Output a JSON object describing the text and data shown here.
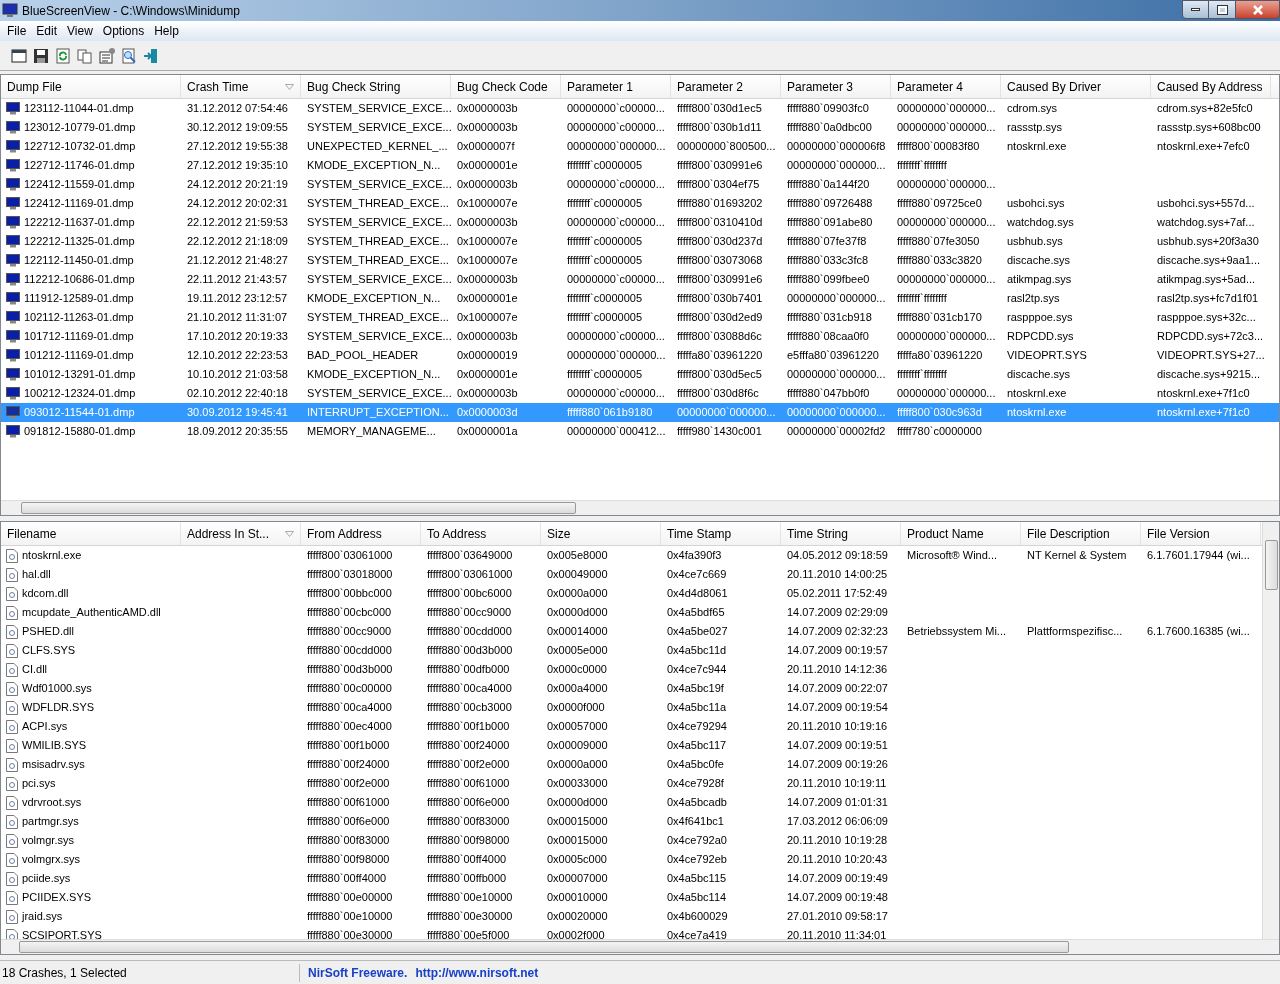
{
  "window": {
    "title": "BlueScreenView  -  C:\\Windows\\Minidump"
  },
  "menu": [
    "File",
    "Edit",
    "View",
    "Options",
    "Help"
  ],
  "crash_list": {
    "columns": [
      {
        "label": "Dump File",
        "sorted": false
      },
      {
        "label": "Crash Time",
        "sorted": true
      },
      {
        "label": "Bug Check String",
        "sorted": false
      },
      {
        "label": "Bug Check Code",
        "sorted": false
      },
      {
        "label": "Parameter 1",
        "sorted": false
      },
      {
        "label": "Parameter 2",
        "sorted": false
      },
      {
        "label": "Parameter 3",
        "sorted": false
      },
      {
        "label": "Parameter 4",
        "sorted": false
      },
      {
        "label": "Caused By Driver",
        "sorted": false
      },
      {
        "label": "Caused By Address",
        "sorted": false
      }
    ],
    "rows": [
      {
        "selected": false,
        "cells": [
          "123112-11044-01.dmp",
          "31.12.2012 07:54:46",
          "SYSTEM_SERVICE_EXCE...",
          "0x0000003b",
          "00000000`c00000...",
          "fffff800`030d1ec5",
          "fffff880`09903fc0",
          "00000000`000000...",
          "cdrom.sys",
          "cdrom.sys+82e5fc0"
        ]
      },
      {
        "selected": false,
        "cells": [
          "123012-10779-01.dmp",
          "30.12.2012 19:09:55",
          "SYSTEM_SERVICE_EXCE...",
          "0x0000003b",
          "00000000`c00000...",
          "fffff800`030b1d11",
          "fffff880`0a0dbc00",
          "00000000`000000...",
          "rassstp.sys",
          "rassstp.sys+608bc00"
        ]
      },
      {
        "selected": false,
        "cells": [
          "122712-10732-01.dmp",
          "27.12.2012 19:55:38",
          "UNEXPECTED_KERNEL_...",
          "0x0000007f",
          "00000000`000000...",
          "00000000`800500...",
          "00000000`000006f8",
          "fffff800`00083f80",
          "ntoskrnl.exe",
          "ntoskrnl.exe+7efc0"
        ]
      },
      {
        "selected": false,
        "cells": [
          "122712-11746-01.dmp",
          "27.12.2012 19:35:10",
          "KMODE_EXCEPTION_N...",
          "0x0000001e",
          "ffffffff`c0000005",
          "fffff800`030991e6",
          "00000000`000000...",
          "ffffffff`ffffffff",
          null,
          null
        ]
      },
      {
        "selected": false,
        "cells": [
          "122412-11559-01.dmp",
          "24.12.2012 20:21:19",
          "SYSTEM_SERVICE_EXCE...",
          "0x0000003b",
          "00000000`c00000...",
          "fffff800`0304ef75",
          "fffff880`0a144f20",
          "00000000`000000...",
          null,
          null
        ]
      },
      {
        "selected": false,
        "cells": [
          "122412-11169-01.dmp",
          "24.12.2012 20:02:31",
          "SYSTEM_THREAD_EXCE...",
          "0x1000007e",
          "ffffffff`c0000005",
          "fffff880`01693202",
          "fffff880`09726488",
          "fffff880`09725ce0",
          "usbohci.sys",
          "usbohci.sys+557d..."
        ]
      },
      {
        "selected": false,
        "cells": [
          "122212-11637-01.dmp",
          "22.12.2012 21:59:53",
          "SYSTEM_SERVICE_EXCE...",
          "0x0000003b",
          "00000000`c00000...",
          "fffff800`0310410d",
          "fffff880`091abe80",
          "00000000`000000...",
          "watchdog.sys",
          "watchdog.sys+7af..."
        ]
      },
      {
        "selected": false,
        "cells": [
          "122212-11325-01.dmp",
          "22.12.2012 21:18:09",
          "SYSTEM_THREAD_EXCE...",
          "0x1000007e",
          "ffffffff`c0000005",
          "fffff800`030d237d",
          "fffff880`07fe37f8",
          "fffff880`07fe3050",
          "usbhub.sys",
          "usbhub.sys+20f3a30"
        ]
      },
      {
        "selected": false,
        "cells": [
          "122112-11450-01.dmp",
          "21.12.2012 21:48:27",
          "SYSTEM_THREAD_EXCE...",
          "0x1000007e",
          "ffffffff`c0000005",
          "fffff800`03073068",
          "fffff880`033c3fc8",
          "fffff880`033c3820",
          "discache.sys",
          "discache.sys+9aa1..."
        ]
      },
      {
        "selected": false,
        "cells": [
          "112212-10686-01.dmp",
          "22.11.2012 21:43:57",
          "SYSTEM_SERVICE_EXCE...",
          "0x0000003b",
          "00000000`c00000...",
          "fffff800`030991e6",
          "fffff880`099fbee0",
          "00000000`000000...",
          "atikmpag.sys",
          "atikmpag.sys+5ad..."
        ]
      },
      {
        "selected": false,
        "cells": [
          "111912-12589-01.dmp",
          "19.11.2012 23:12:57",
          "KMODE_EXCEPTION_N...",
          "0x0000001e",
          "ffffffff`c0000005",
          "fffff800`030b7401",
          "00000000`000000...",
          "ffffffff`ffffffff",
          "rasl2tp.sys",
          "rasl2tp.sys+fc7d1f01"
        ]
      },
      {
        "selected": false,
        "cells": [
          "102112-11263-01.dmp",
          "21.10.2012 11:31:07",
          "SYSTEM_THREAD_EXCE...",
          "0x1000007e",
          "ffffffff`c0000005",
          "fffff800`030d2ed9",
          "fffff880`031cb918",
          "fffff880`031cb170",
          "raspppoe.sys",
          "raspppoe.sys+32c..."
        ]
      },
      {
        "selected": false,
        "cells": [
          "101712-11169-01.dmp",
          "17.10.2012 20:19:33",
          "SYSTEM_SERVICE_EXCE...",
          "0x0000003b",
          "00000000`c00000...",
          "fffff800`03088d6c",
          "fffff880`08caa0f0",
          "00000000`000000...",
          "RDPCDD.sys",
          "RDPCDD.sys+72c3..."
        ]
      },
      {
        "selected": false,
        "cells": [
          "101212-11169-01.dmp",
          "12.10.2012 22:23:53",
          "BAD_POOL_HEADER",
          "0x00000019",
          "00000000`000000...",
          "fffffa80`03961220",
          "e5fffa80`03961220",
          "fffffa80`03961220",
          "VIDEOPRT.SYS",
          "VIDEOPRT.SYS+27..."
        ]
      },
      {
        "selected": false,
        "cells": [
          "101012-13291-01.dmp",
          "10.10.2012 21:03:58",
          "KMODE_EXCEPTION_N...",
          "0x0000001e",
          "ffffffff`c0000005",
          "fffff800`030d5ec5",
          "00000000`000000...",
          "ffffffff`ffffffff",
          "discache.sys",
          "discache.sys+9215..."
        ]
      },
      {
        "selected": false,
        "cells": [
          "100212-12324-01.dmp",
          "02.10.2012 22:40:18",
          "SYSTEM_SERVICE_EXCE...",
          "0x0000003b",
          "00000000`c00000...",
          "fffff800`030d8f6c",
          "fffff880`047bb0f0",
          "00000000`000000...",
          "ntoskrnl.exe",
          "ntoskrnl.exe+7f1c0"
        ]
      },
      {
        "selected": true,
        "cells": [
          "093012-11544-01.dmp",
          "30.09.2012 19:45:41",
          "INTERRUPT_EXCEPTION...",
          "0x0000003d",
          "fffff880`061b9180",
          "00000000`000000...",
          "00000000`000000...",
          "fffff800`030c963d",
          "ntoskrnl.exe",
          "ntoskrnl.exe+7f1c0"
        ]
      },
      {
        "selected": false,
        "cells": [
          "091812-15880-01.dmp",
          "18.09.2012 20:35:55",
          "MEMORY_MANAGEME...",
          "0x0000001a",
          "00000000`000412...",
          "fffff980`1430c001",
          "00000000`00002fd2",
          "fffff780`c0000000",
          null,
          null
        ]
      }
    ]
  },
  "module_list": {
    "columns": [
      {
        "label": "Filename",
        "sorted": false
      },
      {
        "label": "Address In St...",
        "sorted": true
      },
      {
        "label": "From Address",
        "sorted": false
      },
      {
        "label": "To Address",
        "sorted": false
      },
      {
        "label": "Size",
        "sorted": false
      },
      {
        "label": "Time Stamp",
        "sorted": false
      },
      {
        "label": "Time String",
        "sorted": false
      },
      {
        "label": "Product Name",
        "sorted": false
      },
      {
        "label": "File Description",
        "sorted": false
      },
      {
        "label": "File Version",
        "sorted": false
      }
    ],
    "rows": [
      [
        "ntoskrnl.exe",
        null,
        "fffff800`03061000",
        "fffff800`03649000",
        "0x005e8000",
        "0x4fa390f3",
        "04.05.2012 09:18:59",
        "Microsoft® Wind...",
        "NT Kernel & System",
        "6.1.7601.17944 (wi..."
      ],
      [
        "hal.dll",
        null,
        "fffff800`03018000",
        "fffff800`03061000",
        "0x00049000",
        "0x4ce7c669",
        "20.11.2010 14:00:25",
        null,
        null,
        null
      ],
      [
        "kdcom.dll",
        null,
        "fffff800`00bbc000",
        "fffff800`00bc6000",
        "0x0000a000",
        "0x4d4d8061",
        "05.02.2011 17:52:49",
        null,
        null,
        null
      ],
      [
        "mcupdate_AuthenticAMD.dll",
        null,
        "fffff880`00cbc000",
        "fffff880`00cc9000",
        "0x0000d000",
        "0x4a5bdf65",
        "14.07.2009 02:29:09",
        null,
        null,
        null
      ],
      [
        "PSHED.dll",
        null,
        "fffff880`00cc9000",
        "fffff880`00cdd000",
        "0x00014000",
        "0x4a5be027",
        "14.07.2009 02:32:23",
        "Betriebssystem Mi...",
        "Plattformspezifisc...",
        "6.1.7600.16385 (wi..."
      ],
      [
        "CLFS.SYS",
        null,
        "fffff880`00cdd000",
        "fffff880`00d3b000",
        "0x0005e000",
        "0x4a5bc11d",
        "14.07.2009 00:19:57",
        null,
        null,
        null
      ],
      [
        "CI.dll",
        null,
        "fffff880`00d3b000",
        "fffff880`00dfb000",
        "0x000c0000",
        "0x4ce7c944",
        "20.11.2010 14:12:36",
        null,
        null,
        null
      ],
      [
        "Wdf01000.sys",
        null,
        "fffff880`00c00000",
        "fffff880`00ca4000",
        "0x000a4000",
        "0x4a5bc19f",
        "14.07.2009 00:22:07",
        null,
        null,
        null
      ],
      [
        "WDFLDR.SYS",
        null,
        "fffff880`00ca4000",
        "fffff880`00cb3000",
        "0x0000f000",
        "0x4a5bc11a",
        "14.07.2009 00:19:54",
        null,
        null,
        null
      ],
      [
        "ACPI.sys",
        null,
        "fffff880`00ec4000",
        "fffff880`00f1b000",
        "0x00057000",
        "0x4ce79294",
        "20.11.2010 10:19:16",
        null,
        null,
        null
      ],
      [
        "WMILIB.SYS",
        null,
        "fffff880`00f1b000",
        "fffff880`00f24000",
        "0x00009000",
        "0x4a5bc117",
        "14.07.2009 00:19:51",
        null,
        null,
        null
      ],
      [
        "msisadrv.sys",
        null,
        "fffff880`00f24000",
        "fffff880`00f2e000",
        "0x0000a000",
        "0x4a5bc0fe",
        "14.07.2009 00:19:26",
        null,
        null,
        null
      ],
      [
        "pci.sys",
        null,
        "fffff880`00f2e000",
        "fffff880`00f61000",
        "0x00033000",
        "0x4ce7928f",
        "20.11.2010 10:19:11",
        null,
        null,
        null
      ],
      [
        "vdrvroot.sys",
        null,
        "fffff880`00f61000",
        "fffff880`00f6e000",
        "0x0000d000",
        "0x4a5bcadb",
        "14.07.2009 01:01:31",
        null,
        null,
        null
      ],
      [
        "partmgr.sys",
        null,
        "fffff880`00f6e000",
        "fffff880`00f83000",
        "0x00015000",
        "0x4f641bc1",
        "17.03.2012 06:06:09",
        null,
        null,
        null
      ],
      [
        "volmgr.sys",
        null,
        "fffff880`00f83000",
        "fffff880`00f98000",
        "0x00015000",
        "0x4ce792a0",
        "20.11.2010 10:19:28",
        null,
        null,
        null
      ],
      [
        "volmgrx.sys",
        null,
        "fffff880`00f98000",
        "fffff880`00ff4000",
        "0x0005c000",
        "0x4ce792eb",
        "20.11.2010 10:20:43",
        null,
        null,
        null
      ],
      [
        "pciide.sys",
        null,
        "fffff880`00ff4000",
        "fffff880`00ffb000",
        "0x00007000",
        "0x4a5bc115",
        "14.07.2009 00:19:49",
        null,
        null,
        null
      ],
      [
        "PCIIDEX.SYS",
        null,
        "fffff880`00e00000",
        "fffff880`00e10000",
        "0x00010000",
        "0x4a5bc114",
        "14.07.2009 00:19:48",
        null,
        null,
        null
      ],
      [
        "jraid.sys",
        null,
        "fffff880`00e10000",
        "fffff880`00e30000",
        "0x00020000",
        "0x4b600029",
        "27.01.2010 09:58:17",
        null,
        null,
        null
      ],
      [
        "SCSIPORT.SYS",
        null,
        "fffff880`00e30000",
        "fffff880`00e5f000",
        "0x0002f000",
        "0x4ce7a419",
        "20.11.2010 11:34:01",
        null,
        null,
        null
      ]
    ]
  },
  "status_bar": {
    "count": "18 Crashes, 1 Selected",
    "vendor": "NirSoft Freeware.",
    "link": "http://www.nirsoft.net"
  }
}
